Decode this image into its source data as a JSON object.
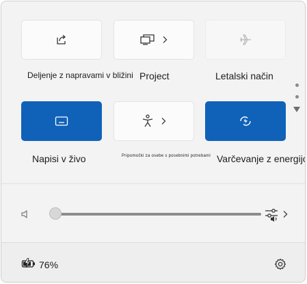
{
  "tiles": [
    {
      "name": "nearby-sharing",
      "label": "Deljenje z napravami v bližini",
      "icon": "share-icon",
      "state": "off"
    },
    {
      "name": "project",
      "label": "Project",
      "icon": "project-display-icon",
      "state": "off",
      "has_submenu": true
    },
    {
      "name": "airplane-mode",
      "label": "Letalski način",
      "icon": "airplane-icon",
      "state": "disabled"
    },
    {
      "name": "live-captions",
      "label": "Napisi v živo",
      "icon": "captions-icon",
      "state": "on"
    },
    {
      "name": "accessibility",
      "label": "Pripomočki za osebe s posebnimi potrebami",
      "icon": "accessibility-icon",
      "state": "off",
      "has_submenu": true
    },
    {
      "name": "energy-saver",
      "label": "Varčevanje z energijo",
      "icon": "energy-saver-icon",
      "state": "on"
    }
  ],
  "volume": {
    "level": 0,
    "icon": "speaker-icon",
    "mixer_icon": "audio-mixer-icon"
  },
  "footer": {
    "battery_percent": "76%",
    "battery_icon": "battery-charging-icon",
    "settings_icon": "gear-icon"
  },
  "colors": {
    "accent": "#0f62b8",
    "panel": "#f3f3f3",
    "footer": "#eeeeee"
  }
}
